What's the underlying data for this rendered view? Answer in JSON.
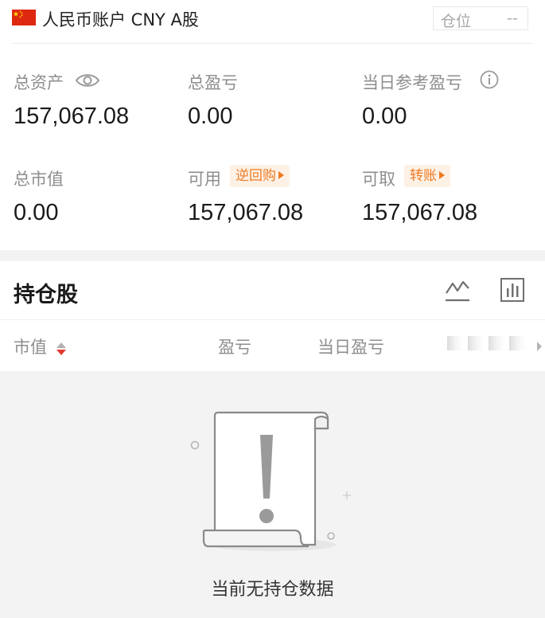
{
  "account": {
    "title": "人民币账户 CNY A股",
    "position_label": "仓位",
    "position_value": "--"
  },
  "metrics": {
    "total_assets": {
      "label": "总资产",
      "value": "157,067.08"
    },
    "total_pnl": {
      "label": "总盈亏",
      "value": "0.00"
    },
    "daily_ref_pnl": {
      "label": "当日参考盈亏",
      "value": "0.00"
    },
    "market_value": {
      "label": "总市值",
      "value": "0.00"
    },
    "available": {
      "label": "可用",
      "tag": "逆回购",
      "value": "157,067.08"
    },
    "withdrawable": {
      "label": "可取",
      "tag": "转账",
      "value": "157,067.08"
    }
  },
  "holdings": {
    "title": "持仓股",
    "columns": [
      "市值",
      "盈亏",
      "当日盈亏"
    ],
    "empty_text": "当前无持仓数据"
  },
  "colors": {
    "accent_orange": "#ee7a22",
    "tag_bg": "#fdf1e6",
    "sort_up_gray": "#b0b0b0",
    "sort_down_red": "#e23a2e",
    "flag_red": "#de2910",
    "flag_star": "#ffde00"
  },
  "icons": {
    "flag": "china-flag-icon",
    "eye": "eye-icon",
    "info": "info-icon",
    "chart": "line-chart-icon",
    "bars": "bar-chart-icon",
    "sort": "sort-icon",
    "more": "more-columns-arrow-icon",
    "empty": "empty-document-icon"
  }
}
